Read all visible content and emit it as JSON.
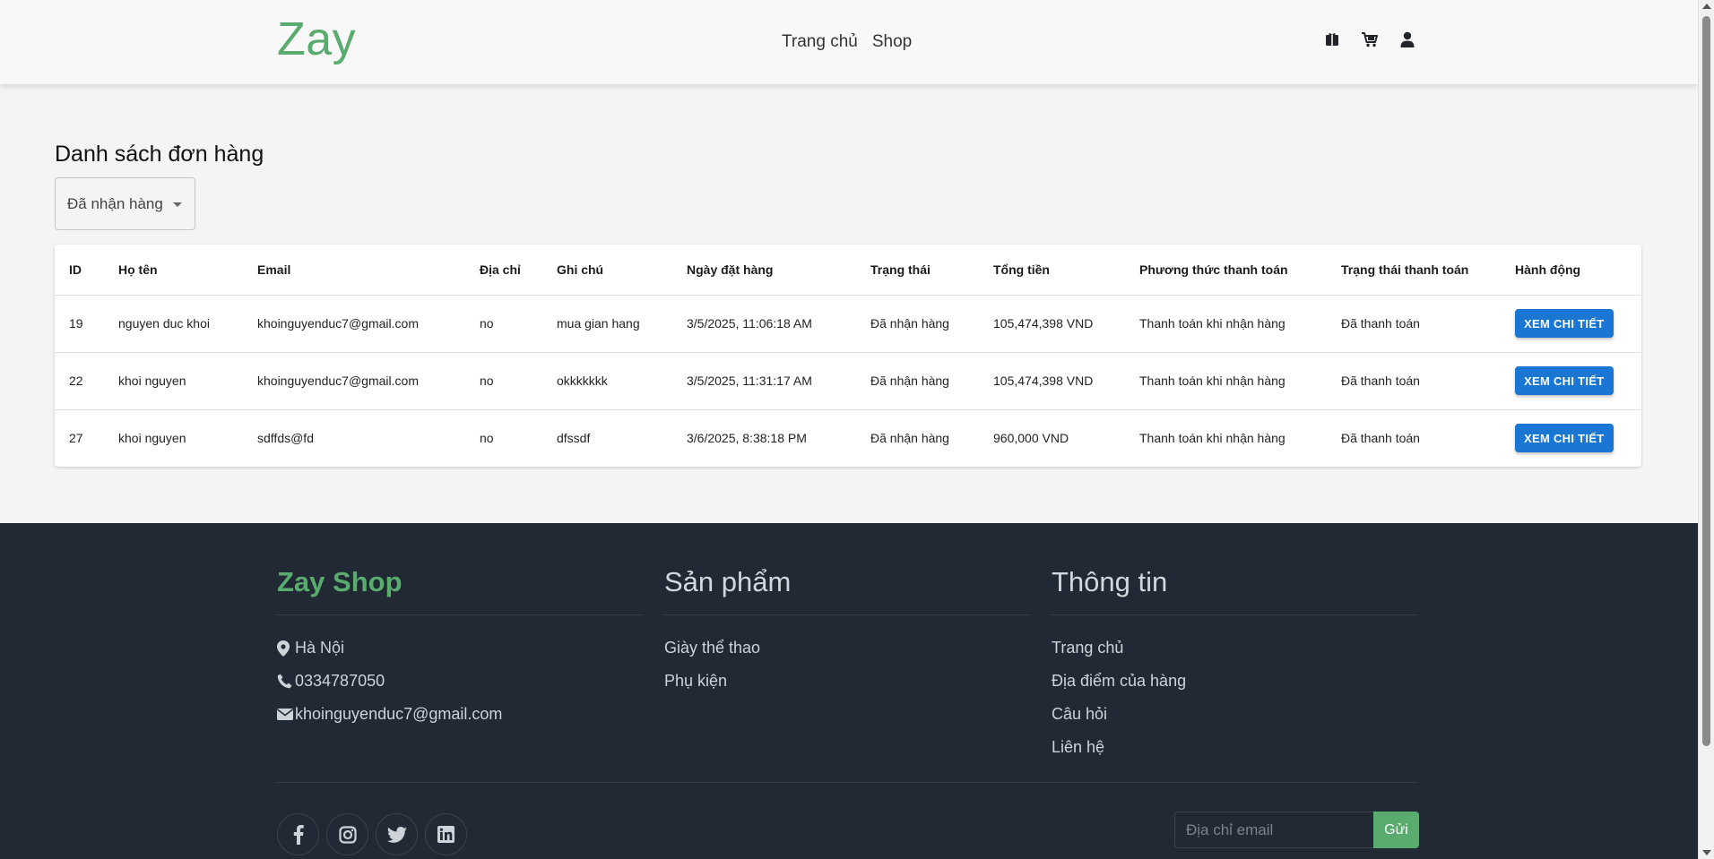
{
  "header": {
    "logo": "Zay",
    "nav": [
      "Trang chủ",
      "Shop"
    ],
    "icons": [
      "gift-icon",
      "cart-icon",
      "user-icon"
    ]
  },
  "page": {
    "title": "Danh sách đơn hàng",
    "filter_value": "Đã nhận hàng"
  },
  "table": {
    "columns": [
      "ID",
      "Họ tên",
      "Email",
      "Địa chỉ",
      "Ghi chú",
      "Ngày đặt hàng",
      "Trạng thái",
      "Tổng tiền",
      "Phương thức thanh toán",
      "Trạng thái thanh toán",
      "Hành động"
    ],
    "rows": [
      {
        "id": "19",
        "name": "nguyen duc khoi",
        "email": "khoinguyenduc7@gmail.com",
        "address": "no",
        "note": "mua gian hang",
        "date": "3/5/2025, 11:06:18 AM",
        "status": "Đã nhận hàng",
        "total": "105,474,398 VND",
        "payment_method": "Thanh toán khi nhận hàng",
        "payment_status": "Đã thanh toán",
        "action": "XEM CHI TIẾT"
      },
      {
        "id": "22",
        "name": "khoi nguyen",
        "email": "khoinguyenduc7@gmail.com",
        "address": "no",
        "note": "okkkkkkk",
        "date": "3/5/2025, 11:31:17 AM",
        "status": "Đã nhận hàng",
        "total": "105,474,398 VND",
        "payment_method": "Thanh toán khi nhận hàng",
        "payment_status": "Đã thanh toán",
        "action": "XEM CHI TIẾT"
      },
      {
        "id": "27",
        "name": "khoi nguyen",
        "email": "sdffds@fd",
        "address": "no",
        "note": "dfssdf",
        "date": "3/6/2025, 8:38:18 PM",
        "status": "Đã nhận hàng",
        "total": "960,000 VND",
        "payment_method": "Thanh toán khi nhận hàng",
        "payment_status": "Đã thanh toán",
        "action": "XEM CHI TIẾT"
      }
    ]
  },
  "footer": {
    "brand": "Zay Shop",
    "contact": [
      {
        "icon": "location-icon",
        "text": "Hà Nội"
      },
      {
        "icon": "phone-icon",
        "text": "0334787050"
      },
      {
        "icon": "mail-icon",
        "text": "khoinguyenduc7@gmail.com"
      }
    ],
    "products_title": "Sản phẩm",
    "products": [
      "Giày thể thao",
      "Phụ kiện"
    ],
    "info_title": "Thông tin",
    "info": [
      "Trang chủ",
      "Địa điểm của hàng",
      "Câu hỏi",
      "Liên hệ"
    ],
    "socials": [
      "facebook-icon",
      "instagram-icon",
      "twitter-icon",
      "linkedin-icon"
    ],
    "email_placeholder": "Địa chỉ email",
    "submit_label": "Gửi"
  },
  "colors": {
    "brand_green": "#59ab6e",
    "button_blue": "#1976d2",
    "footer_bg": "#212934"
  }
}
